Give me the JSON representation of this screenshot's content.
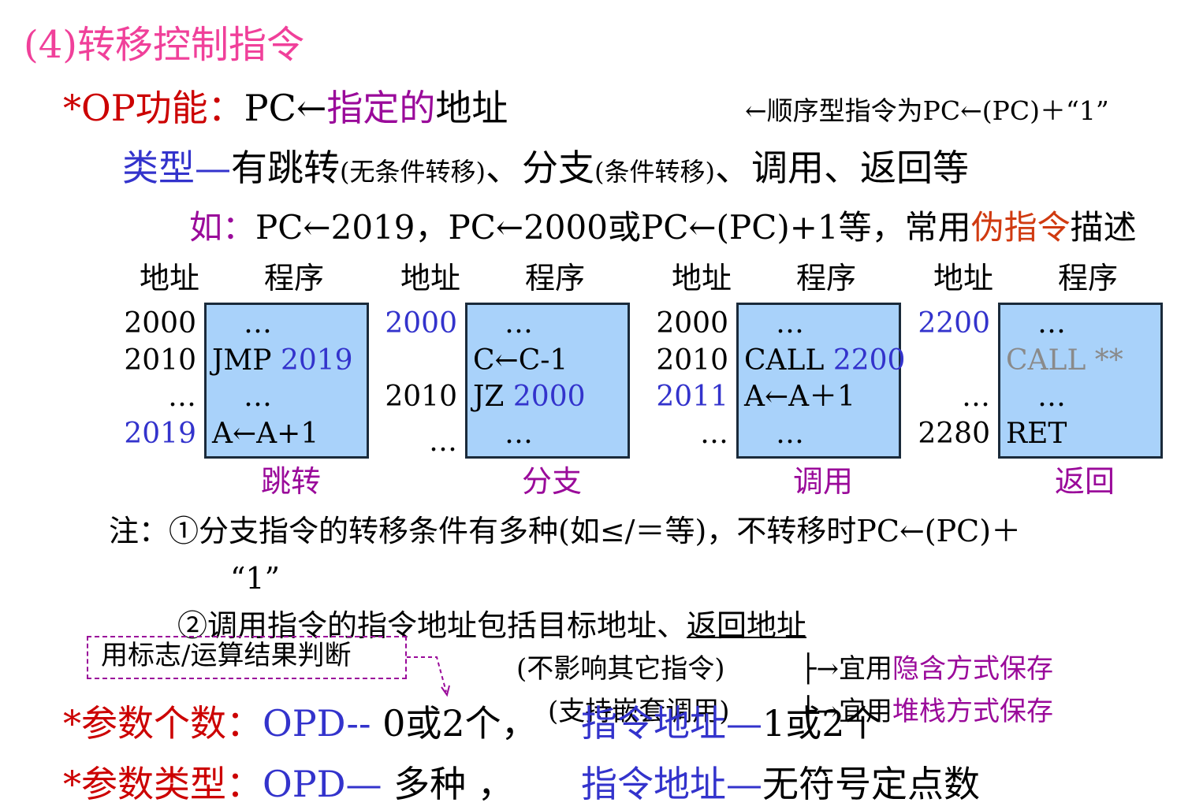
{
  "title": "(4)转移控制指令",
  "op_function": {
    "prefix": "*OP功能：",
    "pc": "PC←",
    "highlight": "指定的",
    "rest": "地址",
    "note": "←顺序型指令为PC←(PC)＋“1”"
  },
  "types": {
    "prefix": "类型—",
    "jump": "有跳转",
    "jump_note": "(无条件转移)",
    "branch": "、分支",
    "branch_note": "(条件转移)",
    "rest": "、调用、返回等"
  },
  "example": {
    "prefix": "如：",
    "text": "PC←2019，PC←2000或PC←(PC)+1等，常用",
    "highlight": "伪指令",
    "rest": "描述"
  },
  "colors": {
    "title": "#f0409a",
    "red": "#cc0000",
    "purple": "#9a0a9a",
    "blue": "#3333cc",
    "orange": "#d03a10",
    "box_fill": "#a9d2fa"
  },
  "blocks": [
    {
      "addr_header": "地址",
      "prog_header": "程序",
      "label": "跳转",
      "rows": [
        {
          "addr": "2000",
          "addr_color": "black",
          "prog": [
            "…",
            ""
          ],
          "prog_color": "black"
        },
        {
          "addr": "2010",
          "addr_color": "black",
          "prog": [
            "JMP ",
            "2019"
          ],
          "prog_color": "black"
        },
        {
          "addr": "…",
          "addr_color": "black",
          "prog": [
            "…",
            ""
          ],
          "prog_color": "black"
        },
        {
          "addr": "2019",
          "addr_color": "blue",
          "prog": [
            "A←A+1",
            ""
          ],
          "prog_color": "black"
        }
      ]
    },
    {
      "addr_header": "地址",
      "prog_header": "程序",
      "label": "分支",
      "rows": [
        {
          "addr": "2000",
          "addr_color": "blue",
          "prog": [
            "…",
            ""
          ],
          "prog_color": "black"
        },
        {
          "addr": "",
          "addr_color": "black",
          "prog": [
            "C←C-1",
            ""
          ],
          "prog_color": "black"
        },
        {
          "addr": "2010",
          "addr_color": "black",
          "prog": [
            "JZ ",
            "2000"
          ],
          "prog_color": "black"
        },
        {
          "addr": "…",
          "addr_color": "black",
          "prog": [
            "…",
            ""
          ],
          "prog_color": "black"
        }
      ]
    },
    {
      "addr_header": "地址",
      "prog_header": "程序",
      "label": "调用",
      "rows": [
        {
          "addr": "2000",
          "addr_color": "black",
          "prog": [
            "…",
            ""
          ],
          "prog_color": "black"
        },
        {
          "addr": "2010",
          "addr_color": "black",
          "prog": [
            "CALL ",
            "2200"
          ],
          "prog_color": "black"
        },
        {
          "addr": "2011",
          "addr_color": "blue",
          "prog": [
            "A←A＋1",
            ""
          ],
          "prog_color": "black"
        },
        {
          "addr": "…",
          "addr_color": "black",
          "prog": [
            "…",
            ""
          ],
          "prog_color": "black"
        }
      ]
    },
    {
      "addr_header": "地址",
      "prog_header": "程序",
      "label": "返回",
      "rows": [
        {
          "addr": "2200",
          "addr_color": "blue",
          "prog": [
            "…",
            ""
          ],
          "prog_color": "black"
        },
        {
          "addr": "",
          "addr_color": "black",
          "prog": [
            "CALL  **",
            ""
          ],
          "prog_color": "gray"
        },
        {
          "addr": "…",
          "addr_color": "black",
          "prog": [
            "…",
            ""
          ],
          "prog_color": "black"
        },
        {
          "addr": "2280",
          "addr_color": "black",
          "prog": [
            "RET",
            ""
          ],
          "prog_color": "black"
        }
      ]
    }
  ],
  "notes": {
    "note1": "注：①分支指令的转移条件有多种(如≤/＝等)，不转移时PC←(PC)＋",
    "note1_cont": "“1”",
    "note2": "②调用指令的指令地址包括目标地址、",
    "note2_underlined": "返回地址",
    "callout": "用标志/运算结果判断",
    "no_affect": "(不影响其它指令)",
    "implicit_prefix": "├→宜用",
    "implicit": "隐含方式保存",
    "nested": "(支持嵌套调用)",
    "stack_prefix": "├→宜用",
    "stack": "堆栈方式保存"
  },
  "param_count": {
    "prefix": "*参数个数：",
    "opd": "OPD--",
    "opd_value": " 0或2个，",
    "addr": "指令地址—",
    "addr_value": "1或2个"
  },
  "param_type": {
    "prefix": "*参数类型：",
    "opd": "OPD—",
    "opd_value": " 多种  ，",
    "addr": "指令地址—",
    "addr_value": "无符号定点数"
  }
}
